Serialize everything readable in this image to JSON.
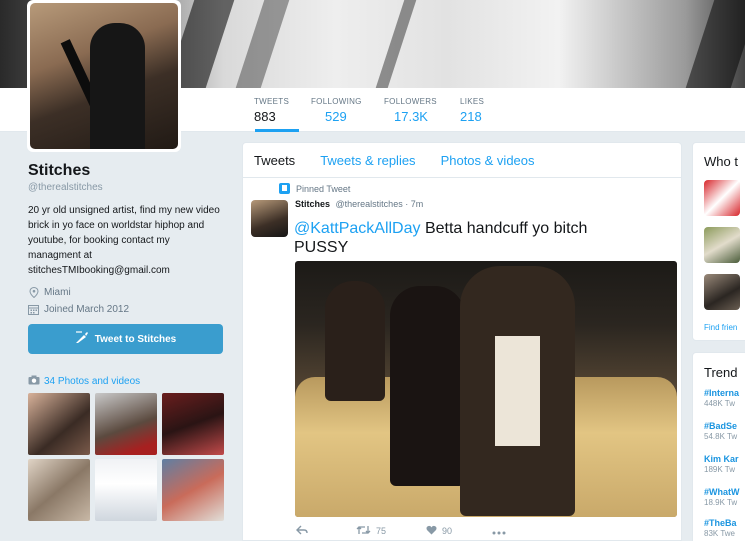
{
  "profile": {
    "name": "Stitches",
    "handle": "@therealstitches",
    "bio": "20 yr old unsigned artist, find my new video brick in yo face on worldstar hiphop and youtube, for booking contact my managment at stitchesTMIbooking@gmail.com",
    "location": "Miami",
    "joined": "Joined March 2012",
    "tweet_to_label": "Tweet to Stitches",
    "photos_label": "34 Photos and videos"
  },
  "stats": [
    {
      "label": "TWEETS",
      "value": "883"
    },
    {
      "label": "FOLLOWING",
      "value": "529"
    },
    {
      "label": "FOLLOWERS",
      "value": "17.3K"
    },
    {
      "label": "LIKES",
      "value": "218"
    }
  ],
  "tabs": [
    {
      "label": "Tweets"
    },
    {
      "label": "Tweets & replies"
    },
    {
      "label": "Photos & videos"
    }
  ],
  "tweet": {
    "pinned_label": "Pinned Tweet",
    "author": "Stitches",
    "handle_time": "@therealstitches · 7m",
    "mention": "@KattPackAllDay",
    "text": " Betta handcuff yo bitch PUSSY",
    "retweets": "75",
    "likes": "90"
  },
  "who_to_follow": {
    "header": "Who t",
    "find_friends": "Find frien"
  },
  "trends": {
    "header": "Trend",
    "items": [
      {
        "name": "#Interna",
        "count": "448K Tw"
      },
      {
        "name": "#BadSe",
        "count": "54.8K Tw"
      },
      {
        "name": "Kim Kar",
        "count": "189K Tw"
      },
      {
        "name": "#WhatW",
        "count": "18.9K Tw"
      },
      {
        "name": "#TheBa",
        "count": "83K Twe"
      }
    ]
  },
  "icons": {
    "location": "location-pin-icon",
    "calendar": "calendar-icon",
    "camera": "camera-icon",
    "reply": "reply-icon",
    "retweet": "retweet-icon",
    "like": "heart-icon",
    "more": "more-icon"
  },
  "colors": {
    "accent": "#1da1f2",
    "tweet_to_button": "#3a9dce"
  }
}
